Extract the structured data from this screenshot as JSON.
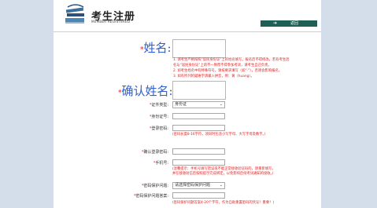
{
  "header": {
    "title": "考生注册",
    "subtitle": "MEMBER REGISTERED",
    "back_label": "返回",
    "back_icon": "arrow-icon"
  },
  "name_section": {
    "label": "姓名:",
    "star": "*",
    "notes": [
      "1. 请考生严格按照“居民身份证”上的姓名填写，报名后不得修改，若有考生因",
      "名与“居民身份证”上的不一致而不得参加考试，请考生自己负责。",
      "2. 如考生姓名中有特殊符号，请按要求填写（如“·”），否则会影响报名。",
      "3. 如有所列的疑难字请输入拼音，例：黄（huang）。"
    ]
  },
  "confirm_name_section": {
    "label": "确认姓名:",
    "star": "*"
  },
  "form": {
    "star": "*",
    "id_type_label": "证件类型:",
    "id_type_value": "身份证",
    "id_number_label": "身份证号:",
    "password_label": "登录密码:",
    "password_hint": "(密码长度8-16字符，须同时包含小写字母、大写字母及数字。)",
    "confirm_password_label": "确认登录密码:",
    "phone_label": "手机号:",
    "phone_hint_1": "(温馨提示：手机号填写错误或不能正常接收验证码的，请重新填写，",
    "phone_hint_2": "并在接收短信后按照提示完成绑定，以免影响后续考试通知的接收。)",
    "security_question_label": "密码保护问题:",
    "security_question_value": "请选择密码保护问题",
    "security_answer_label": "密码保护问题答案:",
    "security_answer_hint": "(密码保护问题答案4-20个字符，作为自助重置密码的凭证！重要！)"
  }
}
